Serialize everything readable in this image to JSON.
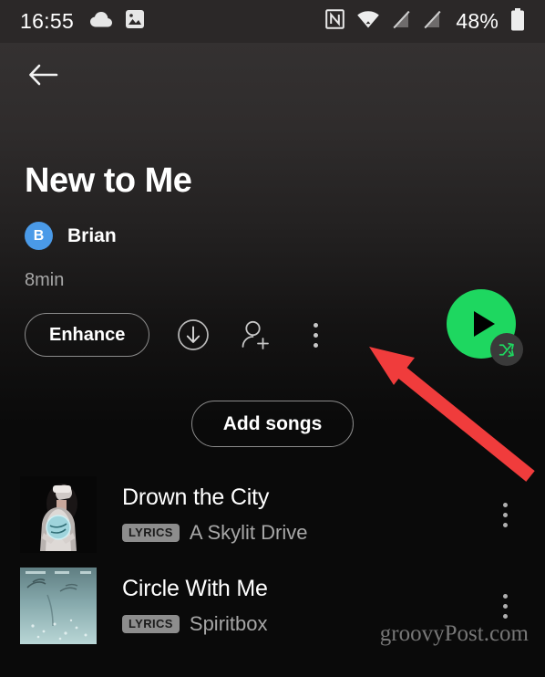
{
  "statusbar": {
    "time": "16:55",
    "battery_text": "48%",
    "left_icons": [
      "cloud-icon",
      "image-icon"
    ],
    "right_icons": [
      "nfc-icon",
      "wifi-icon",
      "signal-off-icon",
      "signal-off-icon-2",
      "battery-icon"
    ]
  },
  "header": {
    "back_icon": "back-arrow-icon",
    "title": "New to Me",
    "owner": {
      "initial": "B",
      "name": "Brian",
      "avatar_color": "#4a9ae8"
    },
    "duration": "8min"
  },
  "actions": {
    "enhance_label": "Enhance",
    "download_icon": "download-circle-icon",
    "add_people_icon": "person-add-icon",
    "more_icon": "kebab-menu-icon",
    "play_icon": "play-icon",
    "shuffle_icon": "shuffle-icon",
    "play_color": "#1ed760"
  },
  "add_songs": {
    "label": "Add songs"
  },
  "tracks": [
    {
      "title": "Drown the City",
      "artist": "A Skylit Drive",
      "badge": "LYRICS",
      "art_name": "album-art-drown-the-city",
      "menu_icon": "kebab-menu-icon"
    },
    {
      "title": "Circle With Me",
      "artist": "Spiritbox",
      "badge": "LYRICS",
      "art_name": "album-art-circle-with-me",
      "menu_icon": "kebab-menu-icon"
    }
  ],
  "annotation": {
    "arrow_color": "#f03c3c",
    "arrow_name": "red-callout-arrow"
  },
  "watermark": {
    "text": "groovyPost.com"
  }
}
